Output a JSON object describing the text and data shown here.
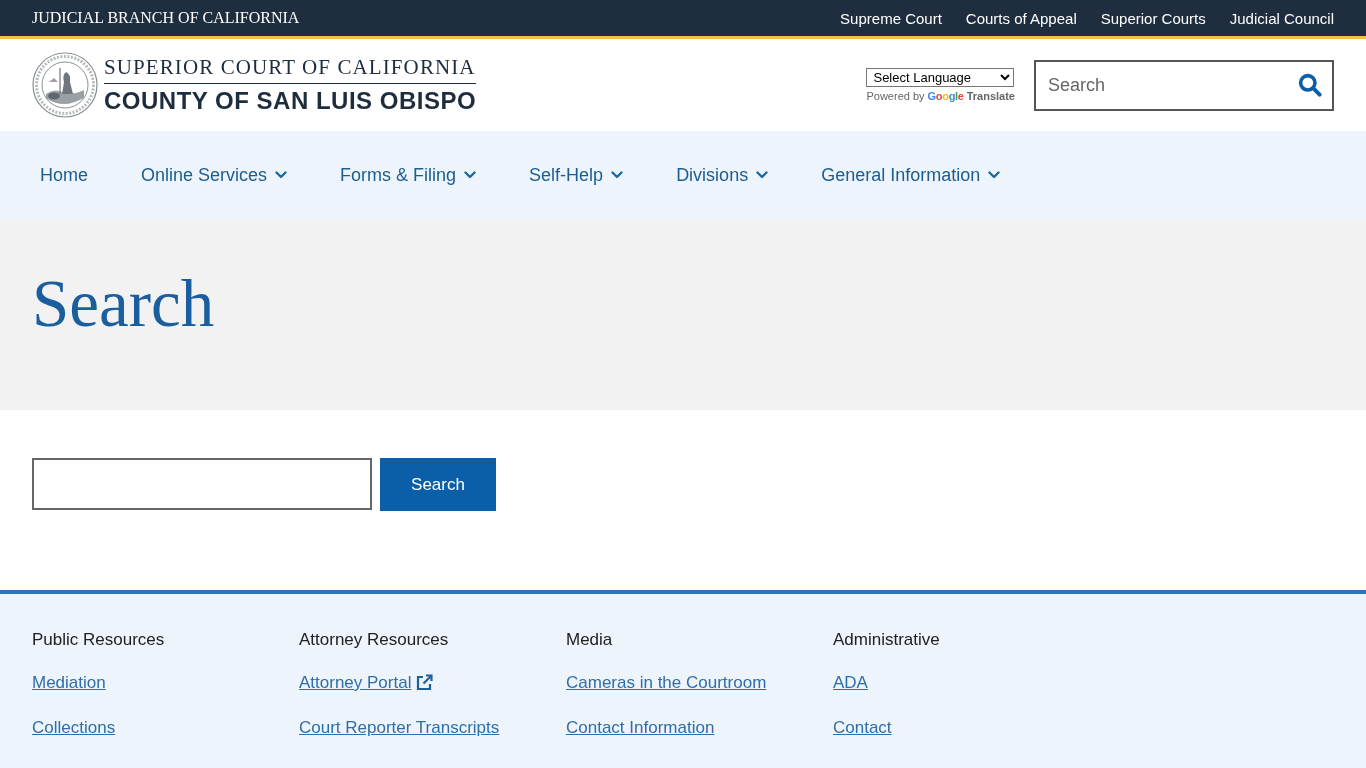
{
  "top_bar": {
    "title": "JUDICIAL BRANCH OF CALIFORNIA",
    "links": [
      "Supreme Court",
      "Courts of Appeal",
      "Superior Courts",
      "Judicial Council"
    ]
  },
  "header": {
    "court_name": "SUPERIOR COURT OF CALIFORNIA",
    "county_name": "COUNTY OF SAN LUIS OBISPO",
    "language_select": "Select Language",
    "translate": {
      "prefix": "Powered by",
      "logo": "Google",
      "label": "Translate"
    },
    "search": {
      "placeholder": "Search"
    }
  },
  "nav": {
    "items": [
      {
        "label": "Home",
        "has_menu": false
      },
      {
        "label": "Online Services",
        "has_menu": true
      },
      {
        "label": "Forms & Filing",
        "has_menu": true
      },
      {
        "label": "Self-Help",
        "has_menu": true
      },
      {
        "label": "Divisions",
        "has_menu": true
      },
      {
        "label": "General Information",
        "has_menu": true
      }
    ]
  },
  "page_title": "Search",
  "search_form": {
    "button": "Search"
  },
  "footer": {
    "columns": [
      {
        "heading": "Public Resources",
        "links": [
          {
            "label": "Mediation",
            "external": false
          },
          {
            "label": "Collections",
            "external": false
          }
        ]
      },
      {
        "heading": "Attorney Resources",
        "links": [
          {
            "label": "Attorney Portal",
            "external": true
          },
          {
            "label": "Court Reporter Transcripts",
            "external": false
          }
        ]
      },
      {
        "heading": "Media",
        "links": [
          {
            "label": "Cameras in the Courtroom",
            "external": false
          },
          {
            "label": "Contact Information",
            "external": false
          }
        ]
      },
      {
        "heading": "Administrative",
        "links": [
          {
            "label": "ADA",
            "external": false
          },
          {
            "label": "Contact",
            "external": false
          }
        ]
      }
    ]
  }
}
